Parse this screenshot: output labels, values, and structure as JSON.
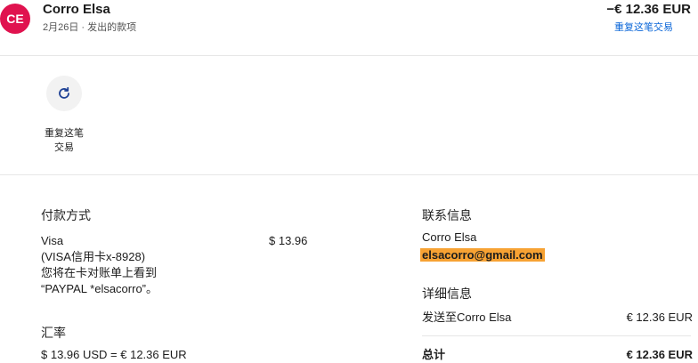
{
  "header": {
    "avatar_initials": "CE",
    "name": "Corro Elsa",
    "subtitle": "2月26日 · 发出的款项",
    "amount": "−€ 12.36 EUR",
    "repeat_link": "重复这笔交易"
  },
  "action": {
    "icon": "refresh-icon",
    "label_line1": "重复这笔",
    "label_line2": "交易"
  },
  "payment": {
    "title": "付款方式",
    "method": "Visa",
    "card": "(VISA信用卡x-8928)",
    "statement_line1": "您将在卡对账单上看到",
    "statement_line2": "“PAYPAL *elsacorro”。",
    "amount": "$ 13.96"
  },
  "exchange": {
    "title": "汇率",
    "value": "$ 13.96 USD = € 12.36 EUR"
  },
  "contact": {
    "title": "联系信息",
    "name": "Corro Elsa",
    "email": "elsacorro@gmail.com"
  },
  "details": {
    "title": "详细信息",
    "sent_to_label": "发送至Corro Elsa",
    "sent_to_amount": "€ 12.36 EUR",
    "total_label": "总计",
    "total_amount": "€ 12.36 EUR"
  },
  "colors": {
    "avatar_bg": "#e0134f",
    "link": "#0a66d8",
    "email_highlight": "#f7a233"
  }
}
